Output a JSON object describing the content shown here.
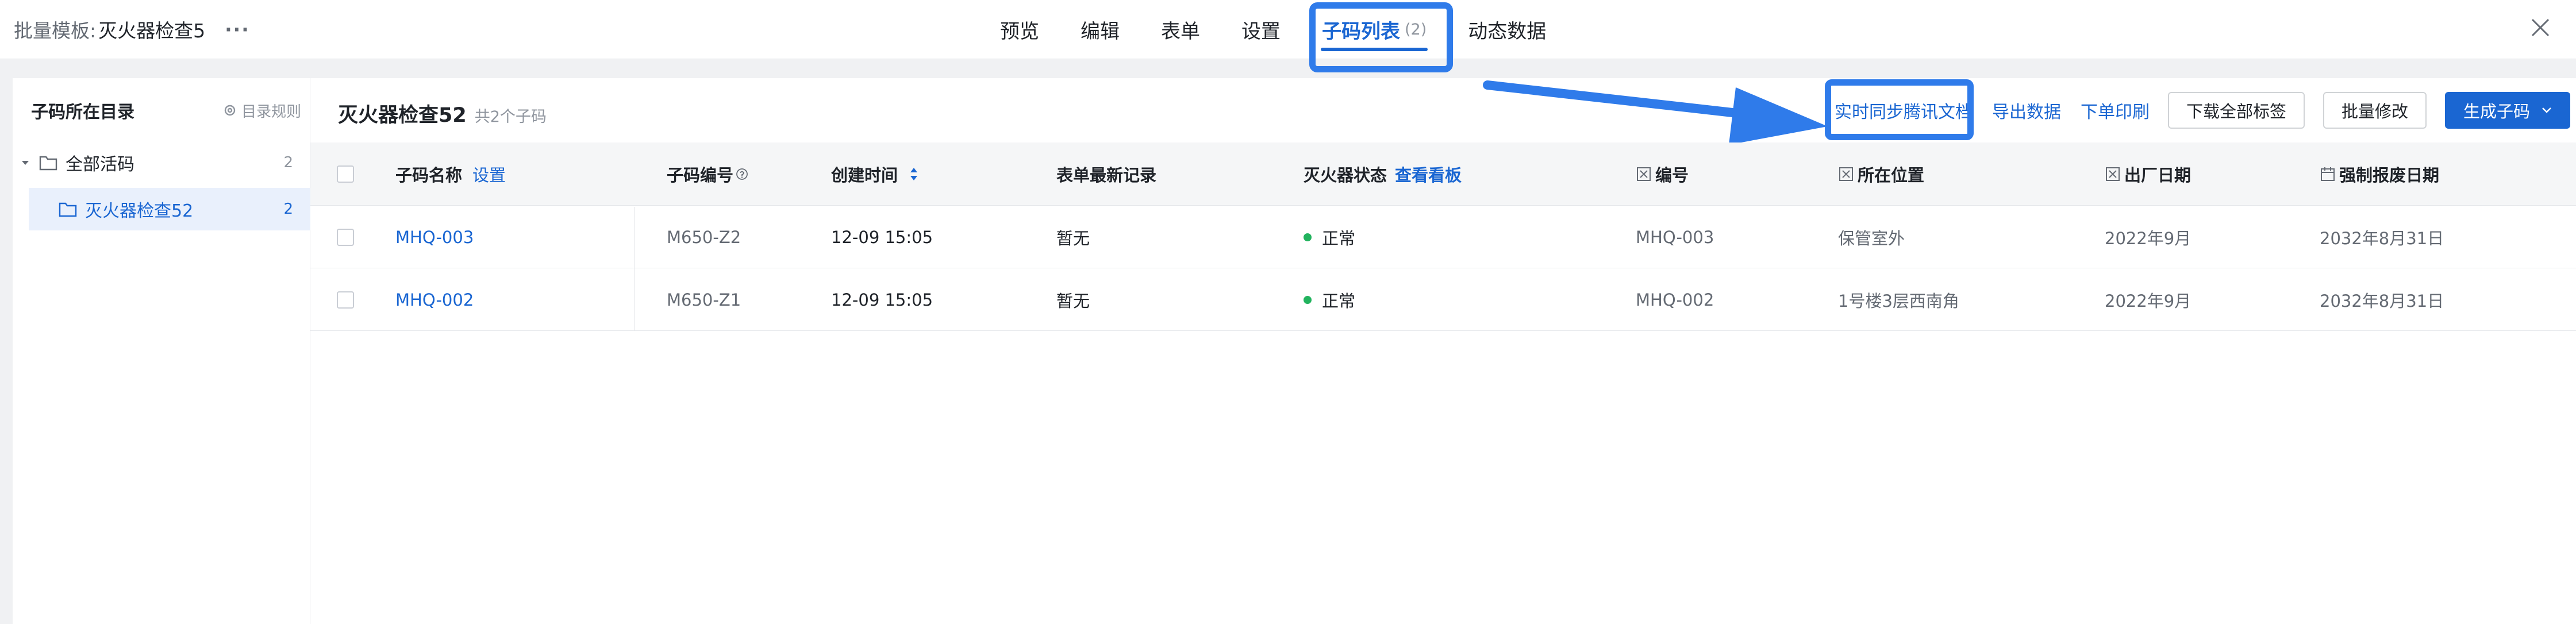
{
  "header": {
    "template_label": "批量模板:",
    "template_name": "灭火器检查5",
    "more": "···",
    "tabs": [
      {
        "label": "预览"
      },
      {
        "label": "编辑"
      },
      {
        "label": "表单"
      },
      {
        "label": "设置"
      },
      {
        "label": "子码列表",
        "count": "(2)"
      },
      {
        "label": "动态数据"
      }
    ]
  },
  "sidebar": {
    "title": "子码所在目录",
    "rule_label": "目录规则",
    "items": [
      {
        "label": "全部活码",
        "count": "2"
      },
      {
        "label": "灭火器检查52",
        "count": "2"
      }
    ]
  },
  "main": {
    "title": "灭火器检查52",
    "subtitle": "共2个子码",
    "actions": {
      "sync_tencent": "实时同步腾讯文档",
      "export": "导出数据",
      "print": "下单印刷",
      "download_labels": "下载全部标签",
      "batch_edit": "批量修改",
      "generate": "生成子码"
    },
    "table": {
      "headers": {
        "name": "子码名称",
        "name_action": "设置",
        "code": "子码编号",
        "created": "创建时间",
        "latest": "表单最新记录",
        "status": "灭火器状态",
        "status_action": "查看看板",
        "number": "编号",
        "location": "所在位置",
        "manufactured": "出厂日期",
        "expiry": "强制报废日期"
      },
      "rows": [
        {
          "name": "MHQ-003",
          "code": "M650-Z2",
          "created": "12-09 15:05",
          "latest": "暂无",
          "status": "正常",
          "number": "MHQ-003",
          "location": "保管室外",
          "manufactured": "2022年9月",
          "expiry": "2032年8月31日"
        },
        {
          "name": "MHQ-002",
          "code": "M650-Z1",
          "created": "12-09 15:05",
          "latest": "暂无",
          "status": "正常",
          "number": "MHQ-002",
          "location": "1号楼3层西南角",
          "manufactured": "2022年9月",
          "expiry": "2032年8月31日"
        }
      ]
    }
  },
  "colors": {
    "accent": "#1a66d2",
    "highlight": "#2f7bea",
    "status_ok": "#22b35e"
  }
}
